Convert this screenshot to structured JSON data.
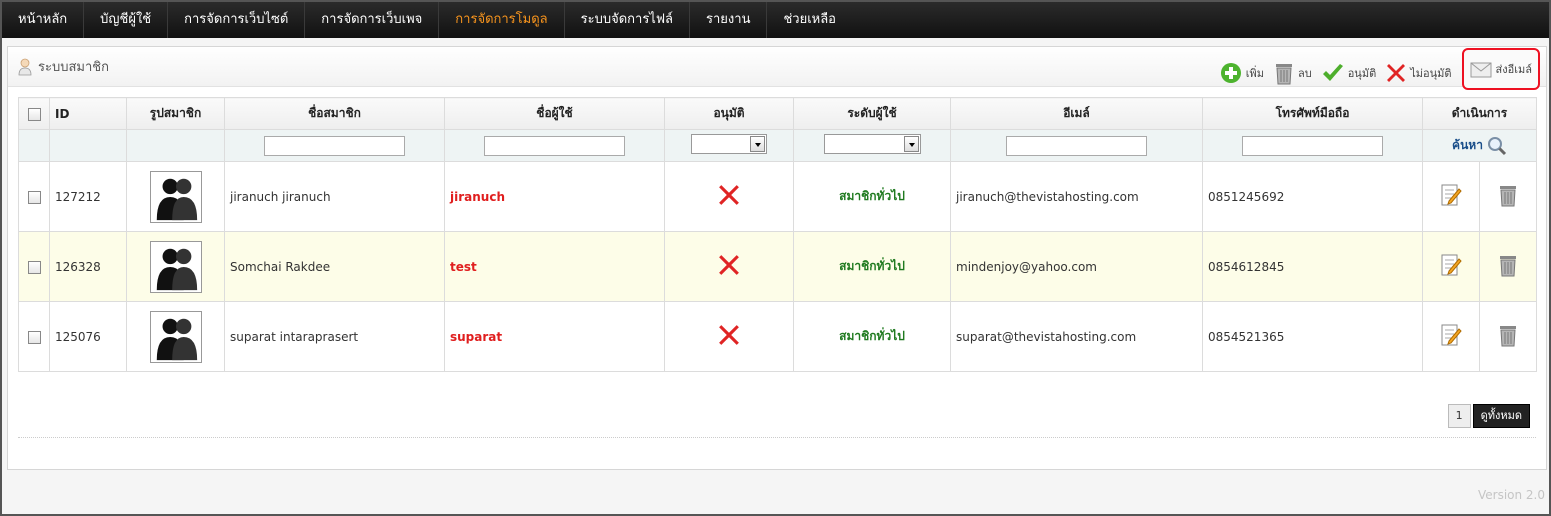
{
  "nav": {
    "items": [
      "หน้าหลัก",
      "บัญชีผู้ใช้",
      "การจัดการเว็บไซต์",
      "การจัดการเว็บเพจ",
      "การจัดการโมดูล",
      "ระบบจัดการไฟล์",
      "รายงาน",
      "ช่วยเหลือ"
    ],
    "active_index": 4
  },
  "panel": {
    "title": "ระบบสมาชิก",
    "toolbar": {
      "add": "เพิ่ม",
      "delete": "ลบ",
      "approve": "อนุมัติ",
      "disapprove": "ไม่อนุมัติ",
      "email": "ส่งอีเมล์"
    }
  },
  "table": {
    "headers": {
      "id": "ID",
      "photo": "รูปสมาชิก",
      "name": "ชื่อสมาชิก",
      "username": "ชื่อผู้ใช้",
      "approved": "อนุมัติ",
      "level": "ระดับผู้ใช้",
      "email": "อีเมล์",
      "phone": "โทรศัพท์มือถือ",
      "actions": "ดำเนินการ"
    },
    "search_label": "ค้นหา",
    "rows": [
      {
        "id": "127212",
        "name": "jiranuch  jiranuch",
        "username": "jiranuch",
        "level": "สมาชิกทั่วไป",
        "email": "jiranuch@thevistahosting.com",
        "phone": "0851245692"
      },
      {
        "id": "126328",
        "name": "Somchai  Rakdee",
        "username": "test",
        "level": "สมาชิกทั่วไป",
        "email": "mindenjoy@yahoo.com",
        "phone": "0854612845"
      },
      {
        "id": "125076",
        "name": "suparat  intaraprasert",
        "username": "suparat",
        "level": "สมาชิกทั่วไป",
        "email": "suparat@thevistahosting.com",
        "phone": "0854521365"
      }
    ]
  },
  "pager": {
    "page": "1",
    "view_all": "ดูทั้งหมด"
  },
  "version": "Version 2.0",
  "colors": {
    "accent": "#f7941d",
    "username": "#e01e1e",
    "level": "#1f7a1f",
    "highlight": "#e11122"
  }
}
